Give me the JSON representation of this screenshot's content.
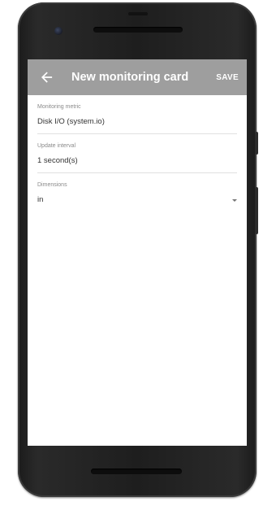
{
  "appbar": {
    "title": "New monitoring card",
    "save_label": "SAVE",
    "color": "#9e9e9e"
  },
  "form": {
    "fields": [
      {
        "label": "Monitoring metric",
        "value": "Disk I/O (system.io)"
      },
      {
        "label": "Update interval",
        "value": "1 second(s)"
      },
      {
        "label": "Dimensions",
        "value": "in"
      }
    ]
  },
  "icons": {
    "back": "arrow-left-icon",
    "dropdown": "triangle-down-icon"
  }
}
